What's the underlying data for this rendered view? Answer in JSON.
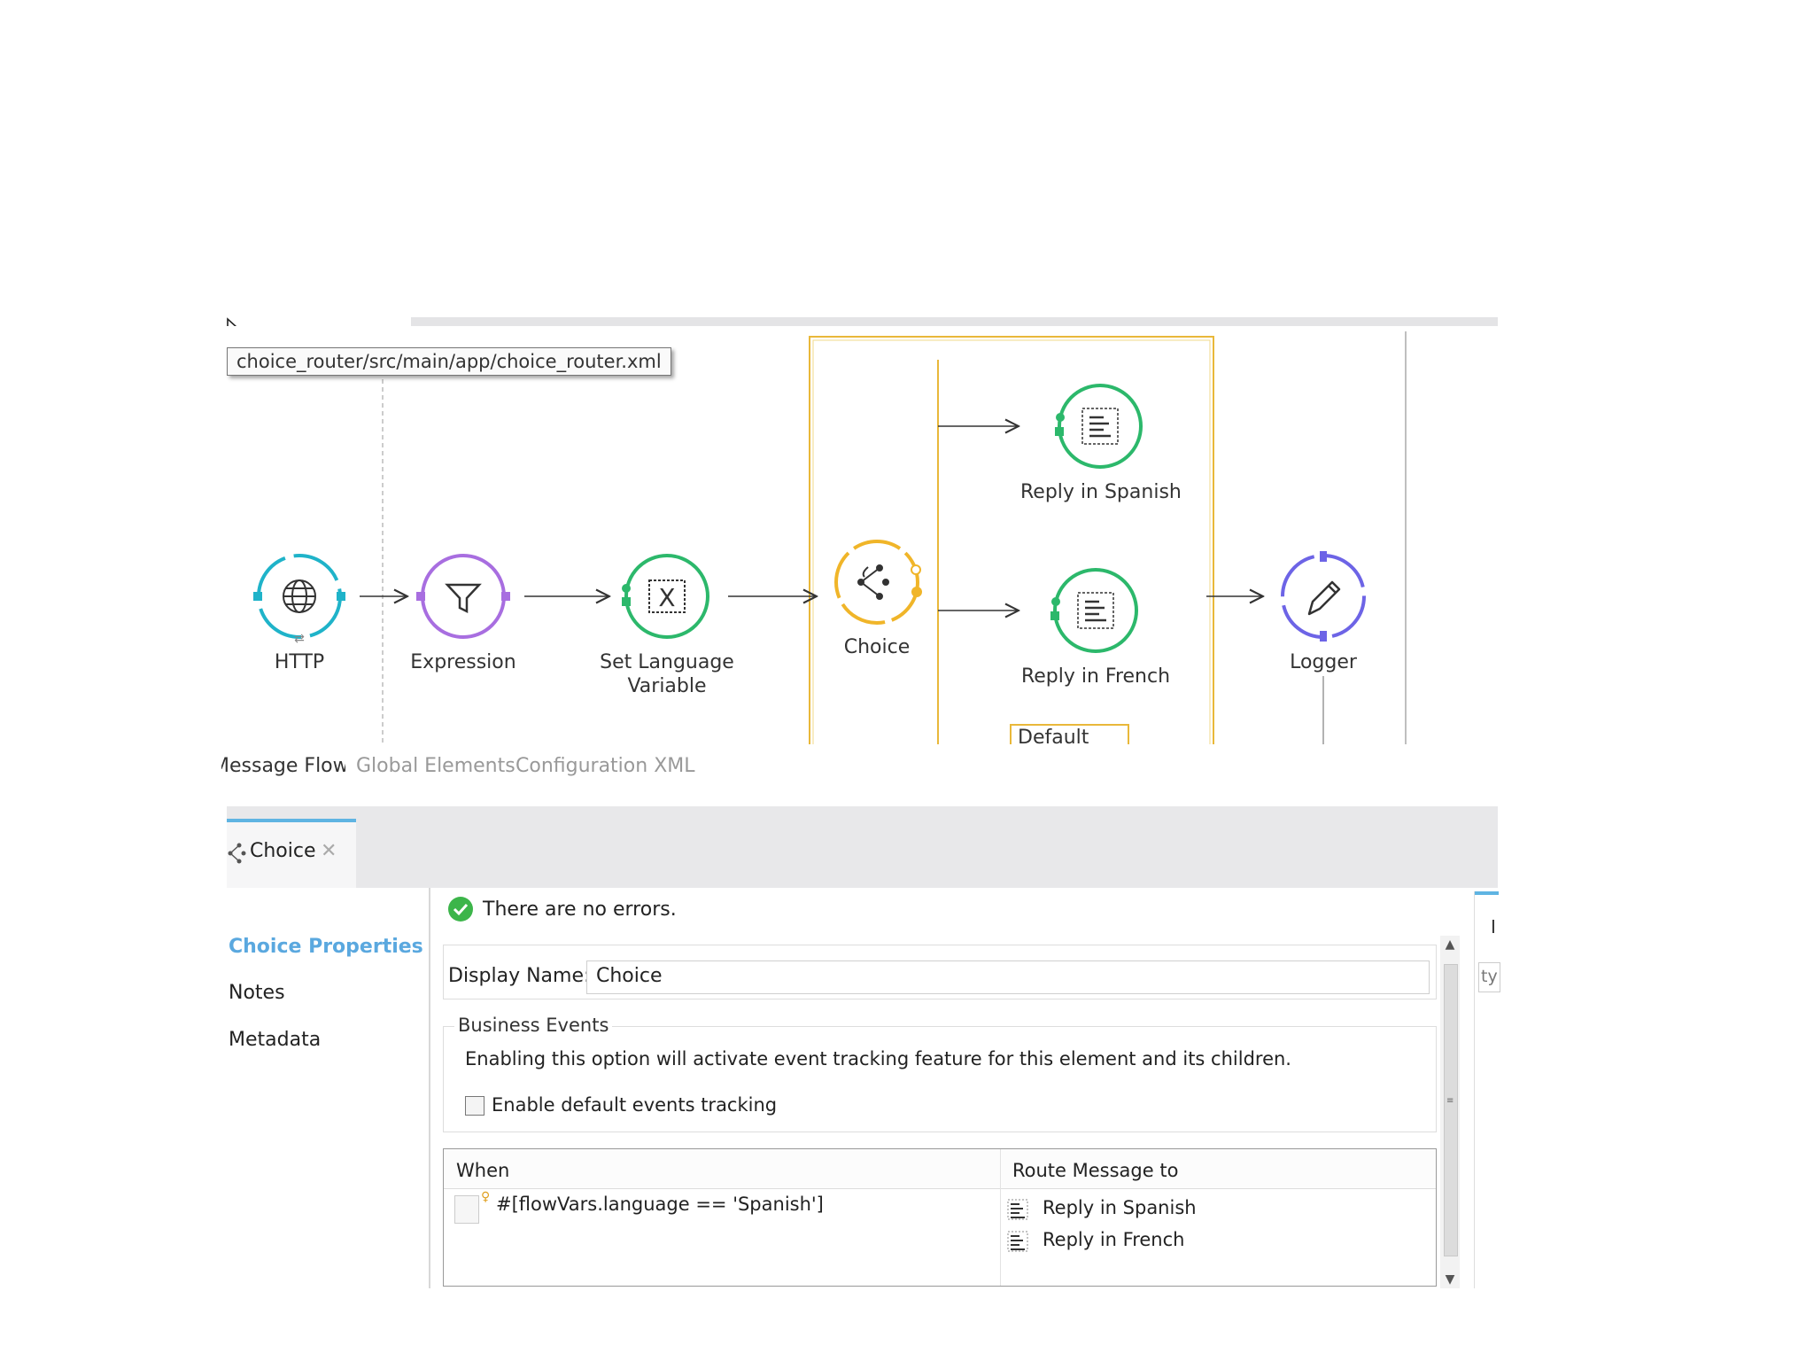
{
  "tooltip": {
    "path": "choice_router/src/main/app/choice_router.xml"
  },
  "flow": {
    "nodes": {
      "http": {
        "label": "HTTP"
      },
      "expression": {
        "label": "Expression"
      },
      "set_variable": {
        "label_line1": "Set Language",
        "label_line2": "Variable"
      },
      "choice": {
        "label": "Choice"
      },
      "reply_spanish": {
        "label": "Reply in Spanish"
      },
      "reply_french": {
        "label": "Reply in French"
      },
      "logger": {
        "label": "Logger"
      }
    },
    "default_lane_label": "Default",
    "colors": {
      "http": "#1fb3c9",
      "expression": "#a86ee0",
      "set_variable": "#2cb86b",
      "choice": "#f0b529",
      "reply": "#2cb86b",
      "logger": "#6d64e6",
      "scope_border": "#e9b83a"
    }
  },
  "editor_tabs": [
    "Message Flow",
    "Global Elements",
    "Configuration XML"
  ],
  "properties_panel": {
    "tab_label": "Choice",
    "tab_icon": "choice-icon",
    "sidebar": [
      "Choice Properties",
      "Notes",
      "Metadata"
    ],
    "status_text": "There are no errors.",
    "display_name_label": "Display Name:",
    "display_name_value": "Choice",
    "business_events": {
      "title": "Business Events",
      "description": "Enabling this option will activate event tracking feature for this element and its children.",
      "checkbox_label": "Enable default events tracking",
      "checked": false
    },
    "routes_table": {
      "columns": [
        "When",
        "Route Message to"
      ],
      "when_expression": "#[flowVars.language == 'Spanish']",
      "targets": [
        "Reply in Spanish",
        "Reply in French"
      ]
    },
    "right_panel": {
      "letter": "I",
      "input_text": "ty"
    }
  }
}
